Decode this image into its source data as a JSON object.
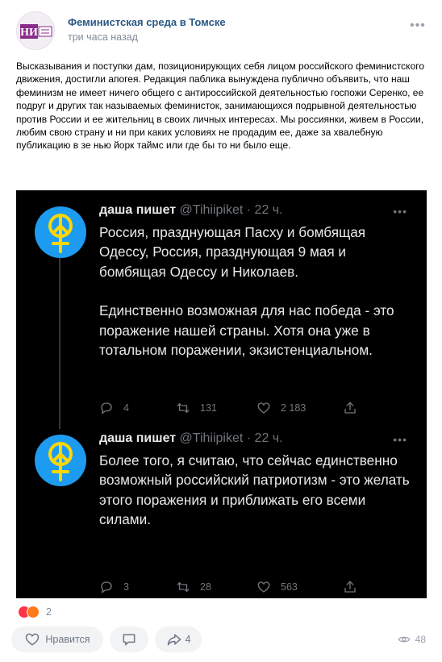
{
  "post": {
    "community_name": "Феминистская среда в Томске",
    "time": "три часа назад",
    "avatar_logo_text": "НИ",
    "text": "Высказывания и поступки дам, позиционирующих себя лицом российского феминистского движения, достигли апогея. Редакция паблика вынуждена публично объявить, что наш феминизм не имеет ничего общего с антироссийской деятельностью госпожи Серенко, ее подруг и других так называемых феминисток, занимающихся подрывной деятельностью против России и ее жительниц в своих личных интересах. Мы россиянки, живем в России, любим свою страну и ни при каких условиях не продадим ее, даже за хвалебную публикацию в зе нью йорк таймс или где бы то ни было еще."
  },
  "tweets": [
    {
      "name": "даша пишет",
      "meta": "@Tihiipiket · 22 ч.",
      "paragraphs": [
        "Россия, празднующая Пасху и бомбящая Одессу, Россия, празднующая 9 мая и бомбящая Одессу и Николаев.",
        "Единственно возможная для нас победа - это поражение нашей страны. Хотя она уже в тотальном поражении, экзистенциальном."
      ],
      "replies": "4",
      "retweets": "131",
      "likes": "2 183"
    },
    {
      "name": "даша пишет",
      "meta": "@Tihiipiket · 22 ч.",
      "paragraphs": [
        "Более того, я считаю, что сейчас единственно возможный российский патриотизм - это желать этого поражения и приближать его всеми силами."
      ],
      "replies": "3",
      "retweets": "28",
      "likes": "563"
    }
  ],
  "reactions": {
    "count": "2"
  },
  "actions": {
    "like_label": "Нравится",
    "share_count": "4",
    "views": "48"
  },
  "icons": {
    "more": "more-horizontal-icon",
    "reply": "reply-icon",
    "retweet": "retweet-icon",
    "like": "heart-icon",
    "share": "share-icon",
    "comment": "comment-icon",
    "views": "eye-icon"
  },
  "colors": {
    "link": "#2a5885",
    "muted": "#818c99",
    "tweet_bg": "#000000",
    "tweet_text": "#e7e9ea",
    "tweet_muted": "#71767b",
    "twitter_blue": "#1d9bf0",
    "symbol_yellow": "#ffd700"
  }
}
